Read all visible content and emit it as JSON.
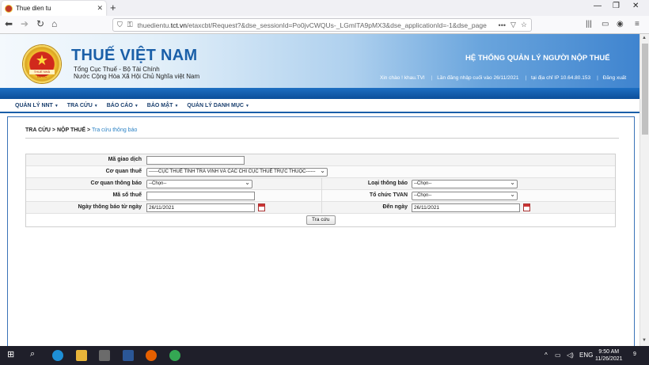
{
  "browser": {
    "tab_title": "Thue dien tu",
    "url_domain": "thuedientu.",
    "url_host": "tct.vn",
    "url_path": "/etaxcbt/Request?&dse_sessionId=Po0jvCWQUs-_LGmITA9pMX3&dse_applicationId=-1&dse_page"
  },
  "header": {
    "brand": "THUẾ VIỆT NAM",
    "line1": "Tổng Cục Thuế - Bộ Tài Chính",
    "line2": "Nước Cộng Hòa Xã Hội Chủ Nghĩa việt Nam",
    "system_title": "HỆ THỐNG QUẢN LÝ NGƯỜI NỘP THUẾ",
    "emblem_text": "THUẾ NHÀ NƯỚC",
    "greeting": "Xin chào ! khau.TVI",
    "last_login": "Lần đăng nhập cuối vào 26/11/2021",
    "ip": "tại địa chỉ IP 10.64.80.153",
    "logout": "Đăng xuất"
  },
  "menu": [
    {
      "label": "QUẢN LÝ NNT"
    },
    {
      "label": "TRA CỨU"
    },
    {
      "label": "BÁO CÁO"
    },
    {
      "label": "BẢO MẬT"
    },
    {
      "label": "QUẢN LÝ DANH MỤC"
    }
  ],
  "breadcrumb": {
    "path": "TRA CỨU > NỘP THUẾ >",
    "current": "Tra cứu thông báo"
  },
  "form": {
    "ma_giao_dich_label": "Mã giao dịch",
    "ma_giao_dich_value": "",
    "co_quan_thue_label": "Cơ quan thuế",
    "co_quan_thue_value": "------CỤC THUẾ TỈNH TRÀ VINH VÀ CÁC CHI CỤC THUẾ TRỰC THUỘC------",
    "co_quan_thong_bao_label": "Cơ quan thông báo",
    "co_quan_thong_bao_value": "--Chọn--",
    "loai_thong_bao_label": "Loại thông báo",
    "loai_thong_bao_value": "--Chọn--",
    "ma_so_thue_label": "Mã số thuế",
    "ma_so_thue_value": "",
    "to_chuc_tvan_label": "Tổ chức TVAN",
    "to_chuc_tvan_value": "--Chọn--",
    "tu_ngay_label": "Ngày thông báo từ ngày",
    "tu_ngay_value": "26/11/2021",
    "den_ngay_label": "Đến ngày",
    "den_ngay_value": "26/11/2021",
    "submit_label": "Tra cứu"
  },
  "taskbar": {
    "lang": "ENG",
    "time": "9:50 AM",
    "date": "11/26/2021",
    "notif_count": "9"
  }
}
